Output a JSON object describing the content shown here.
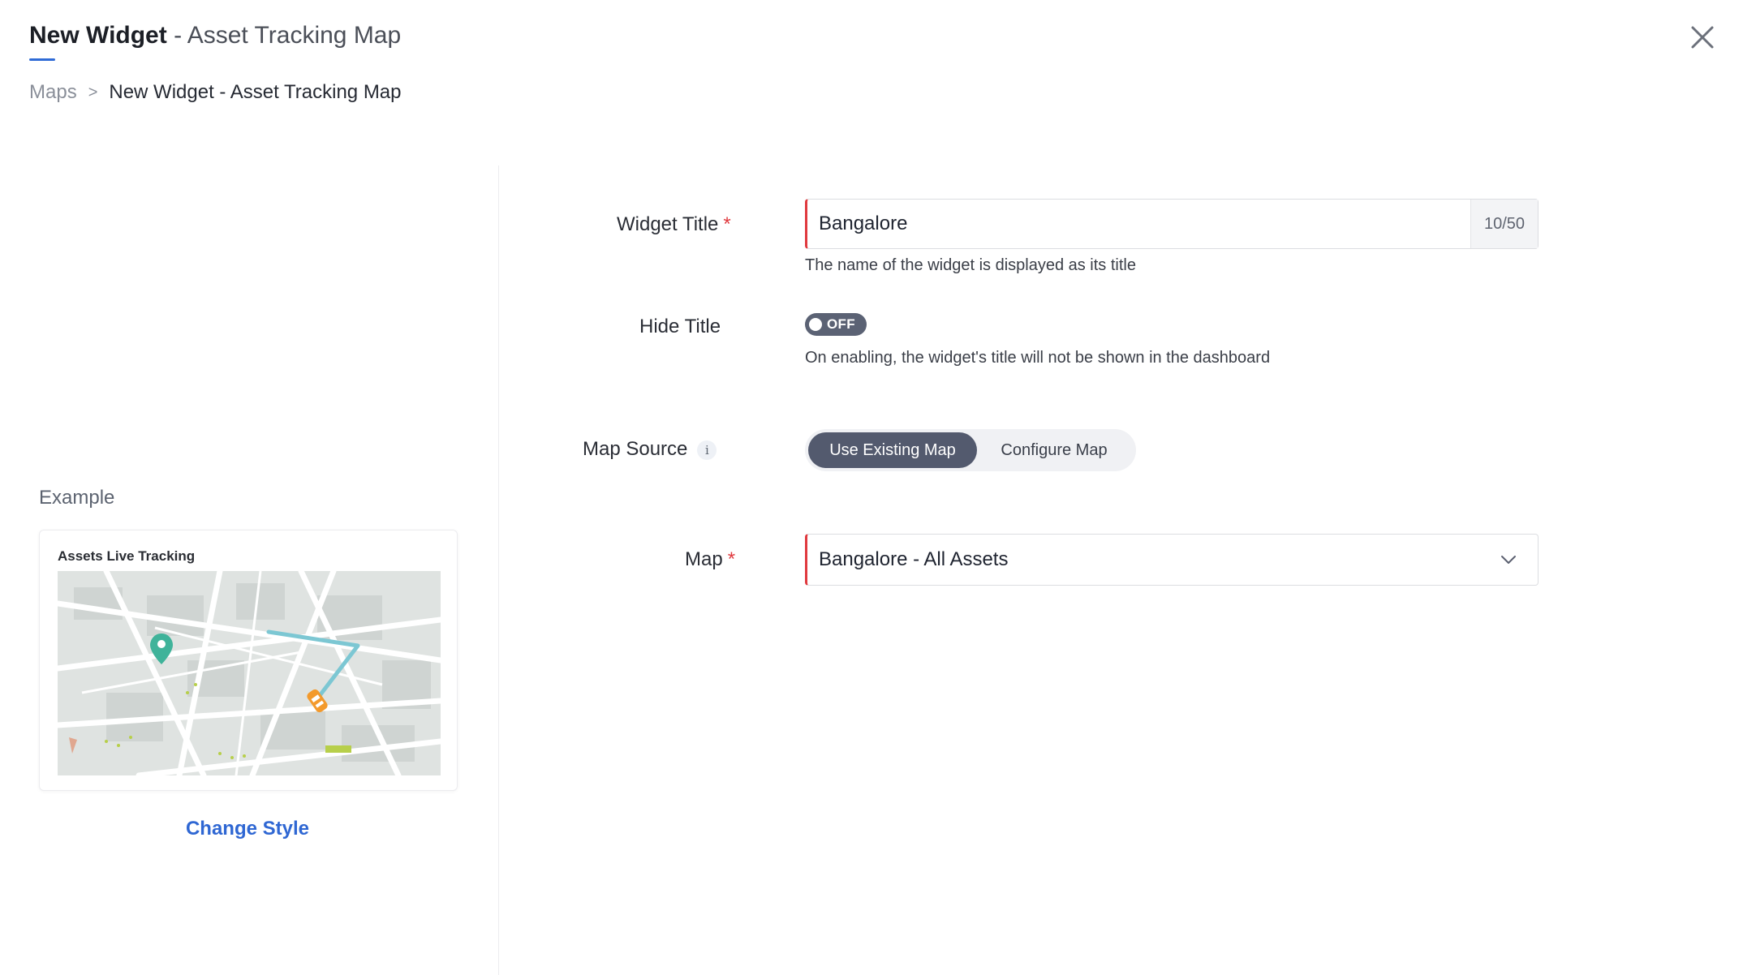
{
  "header": {
    "title_strong": "New Widget",
    "title_sub": " - Asset Tracking Map",
    "close_icon": "close-icon"
  },
  "breadcrumb": {
    "root": "Maps",
    "separator": ">",
    "current": "New Widget - Asset Tracking Map"
  },
  "example": {
    "label": "Example",
    "card_title": "Assets Live Tracking",
    "change_style": "Change Style"
  },
  "form": {
    "widget_title": {
      "label": "Widget Title",
      "required_mark": "*",
      "value": "Bangalore",
      "counter": "10/50",
      "help": "The name of the widget is displayed as its title"
    },
    "hide_title": {
      "label": "Hide Title",
      "toggle_state": "OFF",
      "help": "On enabling, the widget's title will not be shown in the dashboard"
    },
    "map_source": {
      "label": "Map Source",
      "info_glyph": "i",
      "options": [
        "Use Existing Map",
        "Configure Map"
      ],
      "selected": "Use Existing Map"
    },
    "map": {
      "label": "Map",
      "required_mark": "*",
      "value": "Bangalore - All Assets"
    }
  },
  "colors": {
    "accent": "#2f6bd6",
    "required": "#e0393e",
    "toggle_bg": "#5b6274",
    "segment_active": "#535a6e"
  }
}
